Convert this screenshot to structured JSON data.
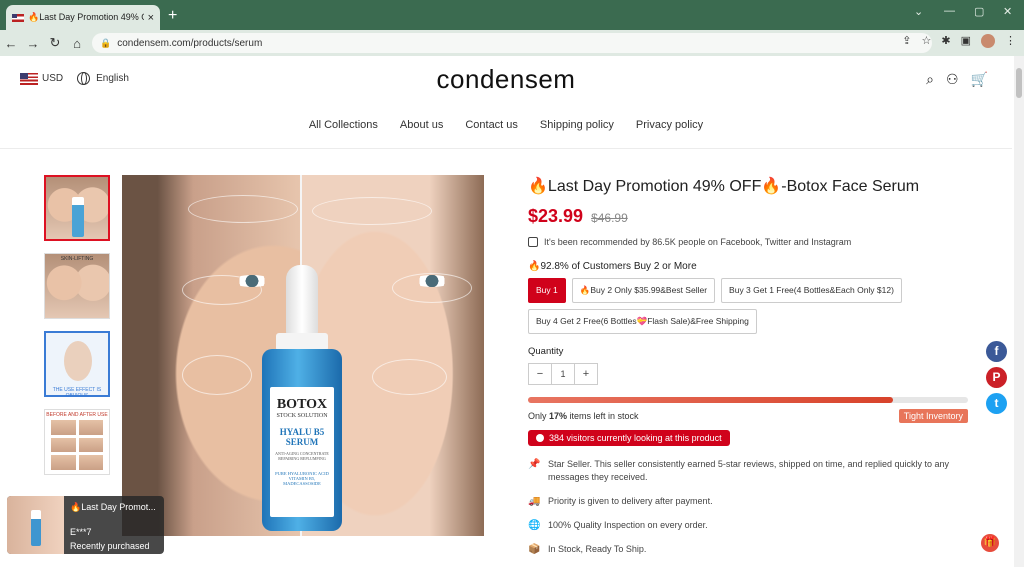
{
  "browser": {
    "tab_title": "🔥Last Day Promotion 49% OFF",
    "tab_close": "×",
    "new_tab": "+",
    "url": "condensem.com/products/serum",
    "win_min": "—",
    "win_max": "▢",
    "win_close": "✕"
  },
  "header": {
    "currency": "USD",
    "language": "English",
    "logo": "condensem"
  },
  "nav": [
    "All Collections",
    "About us",
    "Contact us",
    "Shipping policy",
    "Privacy policy"
  ],
  "gallery": {
    "thumb2_label": "SKIN-LIFTING",
    "thumb3_label": "THE USE EFFECT IS OBVIOUS",
    "thumb4_label": "BEFORE AND AFTER USE",
    "bottle": {
      "brand": "BOTOX",
      "line2": "STOCK SOLUTION",
      "line3": "HYALU B5 SERUM",
      "line4": "ANTI-AGING CONCENTRATE REPAIRING REPLUMPING",
      "line5": "PURE HYALURONIC ACID VITAMIN B5, MADECASSOSIDE"
    }
  },
  "product": {
    "title": "🔥Last Day Promotion 49% OFF🔥-Botox Face Serum",
    "price": "$23.99",
    "compare_price": "$46.99",
    "recommend": "It's been recommended by 86.5K people on Facebook, Twitter and Instagram",
    "customers_note": "🔥92.8% of Customers Buy 2 or More",
    "options": [
      "Buy 1",
      "🔥Buy 2 Only $35.99&Best Seller",
      "Buy 3 Get 1 Free(4 Bottles&Each Only $12)",
      "Buy 4 Get 2 Free(6 Bottles💝Flash Sale)&Free Shipping"
    ],
    "quantity_label": "Quantity",
    "qty_minus": "−",
    "quantity": "1",
    "qty_plus": "+",
    "stock_level": 0.83,
    "stock_prefix": "Only ",
    "stock_percent": "17%",
    "stock_suffix": " items left in stock",
    "tight_inventory": "Tight Inventory",
    "visitors": "384 visitors currently looking at this product",
    "features": [
      "Star Seller. This seller consistently earned 5-star reviews, shipped on time, and replied quickly to any messages they received.",
      "Priority is given to delivery after payment.",
      "100% Quality Inspection on every order.",
      "In Stock, Ready To Ship."
    ]
  },
  "social": {
    "facebook": "f",
    "pinterest": "P",
    "twitter": "t"
  },
  "popup": {
    "title": "🔥Last Day Promot...",
    "name": "E***7",
    "status": "Recently purchased"
  },
  "colors": {
    "accent": "#d0021b",
    "chrome": "#3b6b50"
  }
}
